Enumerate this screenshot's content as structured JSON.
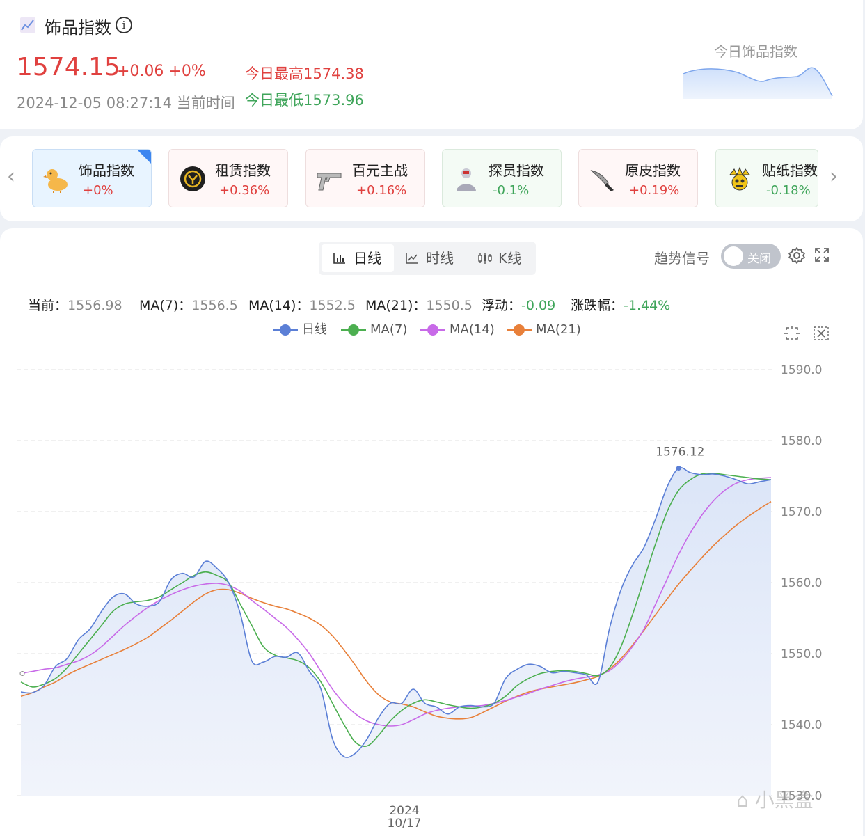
{
  "header": {
    "title": "饰品指数",
    "price": "1574.15",
    "change": "+0.06 +0%",
    "timestamp": "2024-12-05 08:27:14 当前时间",
    "high": "今日最高1574.38",
    "low": "今日最低1573.96",
    "spark_label": "今日饰品指数"
  },
  "tabs": [
    {
      "name": "饰品指数",
      "value": "+0%",
      "color": "#e0413f",
      "style": "active",
      "icon": "duck-icon"
    },
    {
      "name": "租赁指数",
      "value": "+0.36%",
      "color": "#e0413f",
      "style": "red",
      "icon": "rental-logo-icon"
    },
    {
      "name": "百元主战",
      "value": "+0.16%",
      "color": "#e0413f",
      "style": "red",
      "icon": "pistol-icon"
    },
    {
      "name": "探员指数",
      "value": "-0.1%",
      "color": "#3fa55a",
      "style": "green",
      "icon": "agent-icon"
    },
    {
      "name": "原皮指数",
      "value": "+0.19%",
      "color": "#e0413f",
      "style": "red",
      "icon": "knife-icon"
    },
    {
      "name": "贴纸指数",
      "value": "-0.18%",
      "color": "#3fa55a",
      "style": "green",
      "icon": "crown-sticker-icon"
    }
  ],
  "segments": [
    {
      "label": "日线",
      "active": true,
      "icon": "bar-chart-icon"
    },
    {
      "label": "时线",
      "active": false,
      "icon": "line-chart-icon"
    },
    {
      "label": "K线",
      "active": false,
      "icon": "candlestick-icon"
    }
  ],
  "signal": {
    "label": "趋势信号",
    "toggle_label": "关闭"
  },
  "stats": {
    "current_label": "当前：",
    "current": "1556.98",
    "ma7_label": "MA(7)：",
    "ma7": "1556.5",
    "ma14_label": "MA(14)：",
    "ma14": "1552.5",
    "ma21_label": "MA(21)：",
    "ma21": "1550.5",
    "float_label": "浮动：",
    "float": "-0.09",
    "pct_label": "涨跌幅：",
    "pct": "-1.44%"
  },
  "watermark": "小黑盒",
  "chart_data": {
    "type": "line",
    "ylim": [
      1530,
      1590
    ],
    "yticks": [
      "1590.0",
      "1580.0",
      "1570.0",
      "1560.0",
      "1550.0",
      "1540.0",
      "1530.0"
    ],
    "xtick": {
      "year": "2024",
      "date": "10/17"
    },
    "grid": true,
    "legend_position": "top",
    "max_label": "1576.12",
    "series": [
      {
        "name": "日线",
        "color": "#5b7fd6",
        "values": [
          1544.6,
          1544.5,
          1545.5,
          1548.2,
          1549.3,
          1552.0,
          1553.5,
          1556.0,
          1558.0,
          1558.4,
          1557.0,
          1556.7,
          1557.3,
          1560.4,
          1561.3,
          1560.8,
          1563.0,
          1562.0,
          1560.0,
          1555.7,
          1549.0,
          1548.8,
          1549.6,
          1549.5,
          1550.1,
          1547.5,
          1545.0,
          1538.0,
          1535.5,
          1536.0,
          1538.0,
          1541.0,
          1543.0,
          1543.0,
          1545.0,
          1543.0,
          1542.5,
          1541.5,
          1542.5,
          1542.7,
          1542.5,
          1543.0,
          1546.5,
          1547.8,
          1548.5,
          1548.2,
          1547.3,
          1547.5,
          1547.3,
          1547.0,
          1546.0,
          1553.5,
          1559.0,
          1562.5,
          1565.0,
          1569.0,
          1573.5,
          1576.12,
          1575.5,
          1575.2,
          1575.3,
          1575.0,
          1574.5,
          1573.9,
          1574.2,
          1574.5
        ]
      },
      {
        "name": "MA(7)",
        "color": "#4caf50",
        "values": [
          1546.0,
          1545.3,
          1545.7,
          1546.5,
          1548.0,
          1550.0,
          1552.0,
          1554.0,
          1556.0,
          1557.0,
          1557.3,
          1557.5,
          1558.0,
          1559.0,
          1560.0,
          1561.0,
          1561.5,
          1561.0,
          1560.0,
          1557.0,
          1554.0,
          1551.0,
          1549.8,
          1549.4,
          1549.0,
          1548.0,
          1546.0,
          1543.0,
          1540.0,
          1537.5,
          1537.0,
          1538.5,
          1540.5,
          1542.0,
          1543.0,
          1543.5,
          1543.2,
          1542.8,
          1542.5,
          1542.3,
          1542.5,
          1543.0,
          1544.0,
          1545.5,
          1546.5,
          1547.2,
          1547.5,
          1547.6,
          1547.5,
          1547.2,
          1546.9,
          1548.0,
          1551.0,
          1555.5,
          1560.5,
          1565.5,
          1570.0,
          1573.0,
          1574.5,
          1575.3,
          1575.4,
          1575.2,
          1575.0,
          1574.8,
          1574.6,
          1574.5
        ]
      },
      {
        "name": "MA(14)",
        "color": "#c86ae8",
        "values": [
          1547.2,
          1547.5,
          1547.8,
          1548.0,
          1548.5,
          1549.0,
          1549.8,
          1551.0,
          1552.5,
          1554.0,
          1555.3,
          1556.5,
          1557.5,
          1558.3,
          1559.0,
          1559.5,
          1559.8,
          1559.9,
          1559.6,
          1558.8,
          1557.5,
          1556.3,
          1555.0,
          1553.7,
          1552.0,
          1550.0,
          1547.5,
          1545.0,
          1543.0,
          1541.5,
          1540.5,
          1540.0,
          1539.8,
          1540.0,
          1540.7,
          1541.5,
          1542.0,
          1542.3,
          1542.5,
          1542.6,
          1542.7,
          1543.0,
          1543.4,
          1543.9,
          1544.4,
          1545.0,
          1545.5,
          1546.0,
          1546.4,
          1546.7,
          1547.0,
          1547.6,
          1549.0,
          1551.0,
          1553.5,
          1557.0,
          1560.5,
          1564.0,
          1567.0,
          1569.5,
          1571.5,
          1573.0,
          1574.0,
          1574.5,
          1574.7,
          1574.8
        ]
      },
      {
        "name": "MA(21)",
        "color": "#e8803a",
        "values": [
          1544.0,
          1544.5,
          1545.3,
          1546.0,
          1547.0,
          1547.8,
          1548.5,
          1549.2,
          1549.9,
          1550.6,
          1551.4,
          1552.3,
          1553.5,
          1554.7,
          1556.0,
          1557.3,
          1558.4,
          1559.0,
          1559.0,
          1558.5,
          1557.8,
          1557.2,
          1556.7,
          1556.3,
          1555.7,
          1555.0,
          1554.0,
          1552.5,
          1550.5,
          1548.3,
          1546.0,
          1544.2,
          1543.2,
          1542.9,
          1542.5,
          1541.8,
          1541.2,
          1540.9,
          1540.8,
          1541.0,
          1541.7,
          1542.5,
          1543.3,
          1544.0,
          1544.6,
          1545.0,
          1545.3,
          1545.6,
          1545.9,
          1546.3,
          1546.8,
          1547.8,
          1549.3,
          1551.2,
          1553.3,
          1555.5,
          1557.7,
          1559.8,
          1561.7,
          1563.5,
          1565.2,
          1566.7,
          1568.1,
          1569.3,
          1570.4,
          1571.4
        ]
      }
    ]
  }
}
